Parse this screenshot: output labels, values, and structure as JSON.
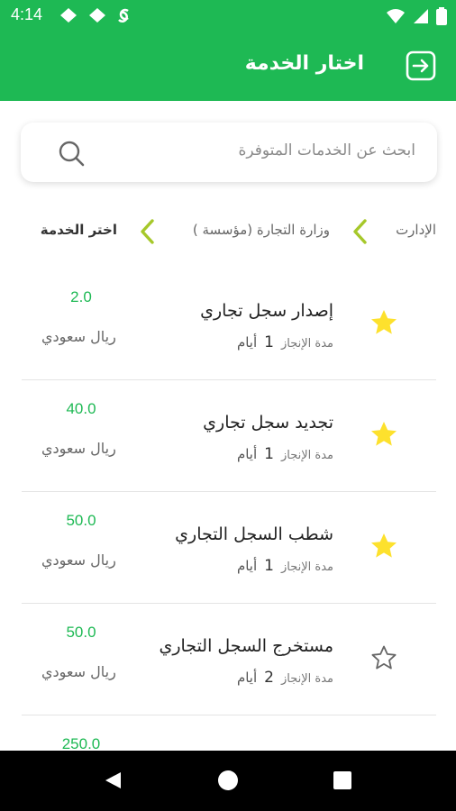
{
  "status_bar": {
    "time": "4:14"
  },
  "app_bar": {
    "title": "اختار الخدمة"
  },
  "search": {
    "placeholder": "ابحث عن الخدمات المتوفرة"
  },
  "breadcrumb": {
    "items": [
      "الإدارت",
      "وزارة التجارة (مؤسسة )",
      "اختر الخدمة"
    ]
  },
  "services": [
    {
      "name": "إصدار سجل تجاري",
      "duration_label": "مدة الإنجاز",
      "duration": "1",
      "duration_unit": "أيام",
      "price": "2.0",
      "currency": "ريال سعودي",
      "favorite": true
    },
    {
      "name": "تجديد سجل تجاري",
      "duration_label": "مدة الإنجاز",
      "duration": "1",
      "duration_unit": "أيام",
      "price": "40.0",
      "currency": "ريال سعودي",
      "favorite": true
    },
    {
      "name": "شطب السجل التجاري",
      "duration_label": "مدة الإنجاز",
      "duration": "1",
      "duration_unit": "أيام",
      "price": "50.0",
      "currency": "ريال سعودي",
      "favorite": true
    },
    {
      "name": "مستخرج السجل التجاري",
      "duration_label": "مدة الإنجاز",
      "duration": "2",
      "duration_unit": "أيام",
      "price": "50.0",
      "currency": "ريال سعودي",
      "favorite": false
    },
    {
      "name": "",
      "duration_label": "",
      "duration": "",
      "duration_unit": "",
      "price": "250.0",
      "currency": "",
      "favorite": false
    }
  ],
  "colors": {
    "primary": "#1eb954",
    "star": "#fde12d",
    "chevron": "#a6c82a"
  },
  "icons": {
    "back": "exit-arrow-icon",
    "search": "search-icon",
    "chevron": "chevron-left-icon",
    "favorite_on": "star-filled-icon",
    "favorite_off": "star-outline-icon"
  }
}
